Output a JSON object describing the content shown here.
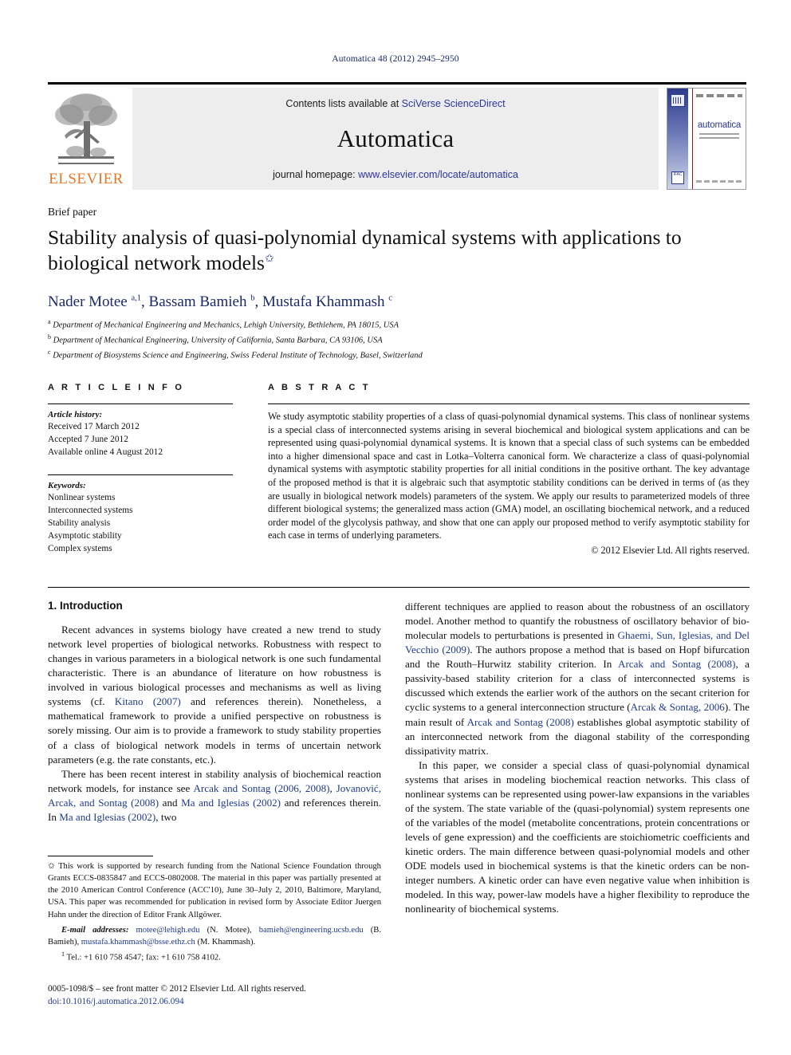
{
  "running_head": "Automatica 48 (2012) 2945–2950",
  "masthead": {
    "contents_prefix": "Contents lists available at ",
    "contents_link": "SciVerse ScienceDirect",
    "journal_title": "Automatica",
    "homepage_prefix": "journal homepage: ",
    "homepage_url": "www.elsevier.com/locate/automatica",
    "publisher": "ELSEVIER",
    "cover_journal_name": "automatica",
    "cover_badge": "IFAC"
  },
  "article": {
    "type_label": "Brief paper",
    "title": "Stability analysis of quasi-polynomial dynamical systems with applications to biological network models",
    "title_marker": "✩",
    "authors_html": "Nader Motee <sup>a,1</sup>, Bassam Bamieh <sup>b</sup>, Mustafa Khammash <sup>c</sup>",
    "affiliations": [
      {
        "mark": "a",
        "text": "Department of Mechanical Engineering and Mechanics, Lehigh University, Bethlehem, PA 18015, USA"
      },
      {
        "mark": "b",
        "text": "Department of Mechanical Engineering, University of California, Santa Barbara, CA 93106, USA"
      },
      {
        "mark": "c",
        "text": "Department of Biosystems Science and Engineering, Swiss Federal Institute of Technology, Basel, Switzerland"
      }
    ]
  },
  "info": {
    "heading": "A R T I C L E   I N F O",
    "history_label": "Article history:",
    "history": [
      "Received 17 March 2012",
      "Accepted 7 June 2012",
      "Available online 4 August 2012"
    ],
    "keywords_label": "Keywords:",
    "keywords": [
      "Nonlinear systems",
      "Interconnected systems",
      "Stability analysis",
      "Asymptotic stability",
      "Complex systems"
    ]
  },
  "abstract": {
    "heading": "A B S T R A C T",
    "text": "We study asymptotic stability properties of a class of quasi-polynomial dynamical systems. This class of nonlinear systems is a special class of interconnected systems arising in several biochemical and biological system applications and can be represented using quasi-polynomial dynamical systems. It is known that a special class of such systems can be embedded into a higher dimensional space and cast in Lotka–Volterra canonical form. We characterize a class of quasi-polynomial dynamical systems with asymptotic stability properties for all initial conditions in the positive orthant. The key advantage of the proposed method is that it is algebraic such that asymptotic stability conditions can be derived in terms of (as they are usually in biological network models) parameters of the system. We apply our results to parameterized models of three different biological systems; the generalized mass action (GMA) model, an oscillating biochemical network, and a reduced order model of the glycolysis pathway, and show that one can apply our proposed method to verify asymptotic stability for each case in terms of underlying parameters.",
    "copyright": "© 2012 Elsevier Ltd. All rights reserved."
  },
  "body": {
    "section_heading": "1. Introduction",
    "left_paragraphs": [
      "Recent advances in systems biology have created a new trend to study network level properties of biological networks. Robustness with respect to changes in various parameters in a biological network is one such fundamental characteristic. There is an abundance of literature on how robustness is involved in various biological processes and mechanisms as well as living systems (cf. <span class=\"ref\">Kitano (2007)</span> and references therein). Nonetheless, a mathematical framework to provide a unified perspective on robustness is sorely missing. Our aim is to provide a framework to study stability properties of a class of biological network models in terms of uncertain network parameters (e.g. the rate constants, etc.).",
      "There has been recent interest in stability analysis of biochemical reaction network models, for instance see <span class=\"ref\">Arcak and Sontag (2006, 2008)</span>, <span class=\"ref\">Jovanović, Arcak, and Sontag (2008)</span> and <span class=\"ref\">Ma and Iglesias (2002)</span> and references therein. In <span class=\"ref\">Ma and Iglesias (2002)</span>, two"
    ],
    "right_paragraphs": [
      "different techniques are applied to reason about the robustness of an oscillatory model. Another method to quantify the robustness of oscillatory behavior of bio-molecular models to perturbations is presented in <span class=\"ref\">Ghaemi, Sun, Iglesias, and Del Vecchio (2009)</span>. The authors propose a method that is based on Hopf bifurcation and the Routh–Hurwitz stability criterion. In <span class=\"ref\">Arcak and Sontag (2008)</span>, a passivity-based stability criterion for a class of interconnected systems is discussed which extends the earlier work of the authors on the secant criterion for cyclic systems to a general interconnection structure (<span class=\"ref\">Arcak &amp; Sontag, 2006</span>). The main result of <span class=\"ref\">Arcak and Sontag (2008)</span> establishes global asymptotic stability of an interconnected network from the diagonal stability of the corresponding dissipativity matrix.",
      "In this paper, we consider a special class of quasi-polynomial dynamical systems that arises in modeling biochemical reaction networks. This class of nonlinear systems can be represented using power-law expansions in the variables of the system. The state variable of the (quasi-polynomial) system represents one of the variables of the model (metabolite concentrations, protein concentrations or levels of gene expression) and the coefficients are stoichiometric coefficients and kinetic orders. The main difference between quasi-polynomial models and other ODE models used in biochemical systems is that the kinetic orders can be non-integer numbers. A kinetic order can have even negative value when inhibition is modeled. In this way, power-law models have a higher flexibility to reproduce the nonlinearity of biochemical systems."
    ]
  },
  "footnotes": {
    "funding": "This work is supported by research funding from the National Science Foundation through Grants ECCS-0835847 and ECCS-0802008. The material in this paper was partially presented at the 2010 American Control Conference (ACC'10), June 30–July 2, 2010, Baltimore, Maryland, USA. This paper was recommended for publication in revised form by Associate Editor Juergen Hahn under the direction of Editor Frank Allgöwer.",
    "funding_marker": "✩",
    "email_label": "E-mail addresses:",
    "emails_html": "<span class=\"mail\">motee@lehigh.edu</span> (N. Motee), <span class=\"mail\">bamieh@engineering.ucsb.edu</span> (B. Bamieh), <span class=\"mail\">mustafa.khammash@bsse.ethz.ch</span> (M. Khammash).",
    "tel_marker": "1",
    "tel": "Tel.: +1 610 758 4547; fax: +1 610 758 4102."
  },
  "imprint": {
    "line1": "0005-1098/$ – see front matter © 2012 Elsevier Ltd. All rights reserved.",
    "doi_prefix": "doi:",
    "doi": "10.1016/j.automatica.2012.06.094"
  }
}
